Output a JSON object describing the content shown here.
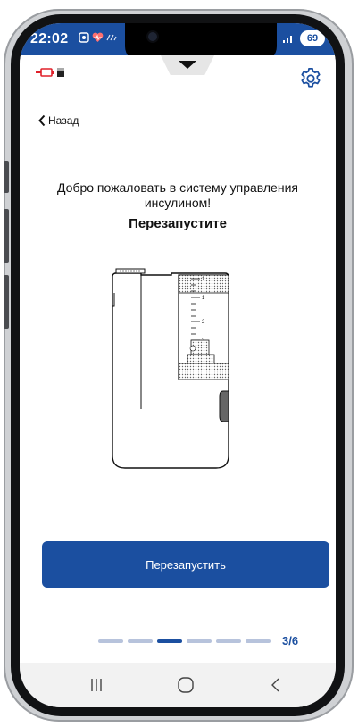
{
  "status_bar": {
    "time": "22:02",
    "battery": "69",
    "signal_icon": "signal-bars-icon",
    "wifi_icon": "wifi-icon"
  },
  "header": {
    "sync_icon": "pump-sync-icon",
    "lock_icon": "device-lock-icon",
    "settings_icon": "gear-icon",
    "pull_down_icon": "chevron-down-icon"
  },
  "nav": {
    "back_label": "Назад"
  },
  "content": {
    "welcome_text": "Добро пожаловать в систему управления инсулином!",
    "step_title": "Перезапустите",
    "illustration": "insulin-pump-reservoir-illustration"
  },
  "action": {
    "button_label": "Перезапустить"
  },
  "progress": {
    "current": 3,
    "total": 6,
    "label": "3/6"
  },
  "system_nav": {
    "recent_icon": "recent-apps-icon",
    "home_icon": "home-icon",
    "back_icon": "back-icon"
  },
  "colors": {
    "primary": "#1b4fa0",
    "progress_inactive": "#b7c3dc",
    "sync_red": "#e0202a"
  }
}
